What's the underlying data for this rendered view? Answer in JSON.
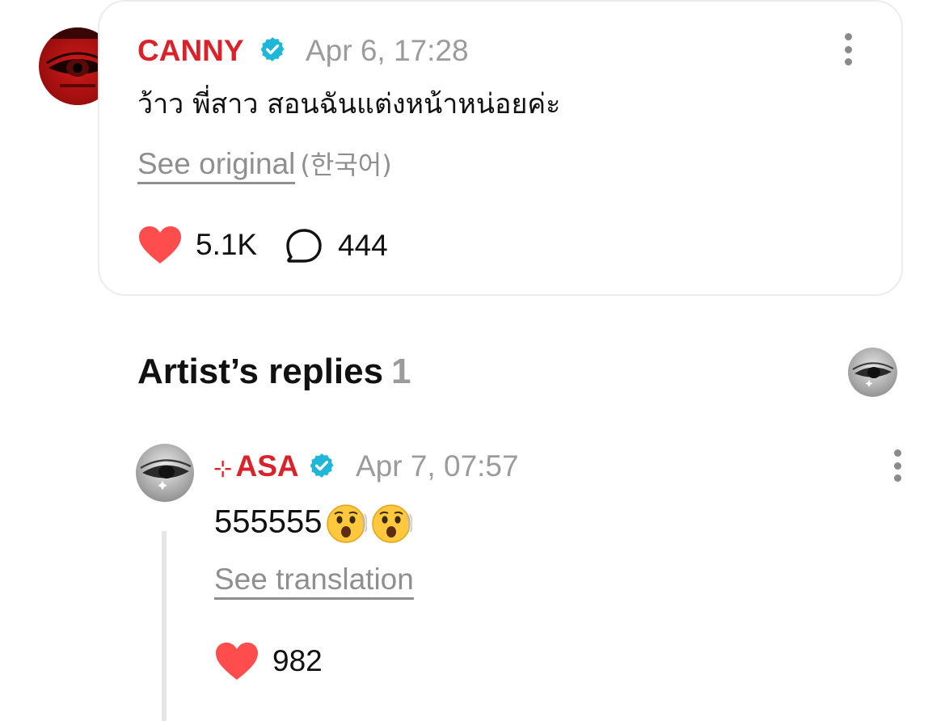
{
  "comment": {
    "author": "CANNY",
    "timestamp": "Apr 6, 17:28",
    "text": "ว้าว พี่สาว สอนฉันแต่งหน้าหน่อยค่ะ",
    "see_original_label": "See original",
    "original_language": "(한국어)",
    "likes": "5.1K",
    "comments": "444",
    "accent_color": "#d9222a"
  },
  "replies": {
    "title": "Artist’s replies",
    "count": "1"
  },
  "reply": {
    "author_prefix": "⊹",
    "author": "ASA",
    "timestamp": "Apr 7, 07:57",
    "text": "555555",
    "emoji": [
      "astonished-face-emoji",
      "astonished-face-emoji"
    ],
    "see_translation_label": "See translation",
    "likes": "982"
  },
  "icons": {
    "verified": "verified-badge-icon",
    "more": "more-vertical-icon",
    "like": "heart-icon",
    "comment": "speech-bubble-icon"
  },
  "colors": {
    "heart": "#ff4d4d",
    "verified": "#1fb6d8",
    "muted_text": "#9b9b9b"
  }
}
